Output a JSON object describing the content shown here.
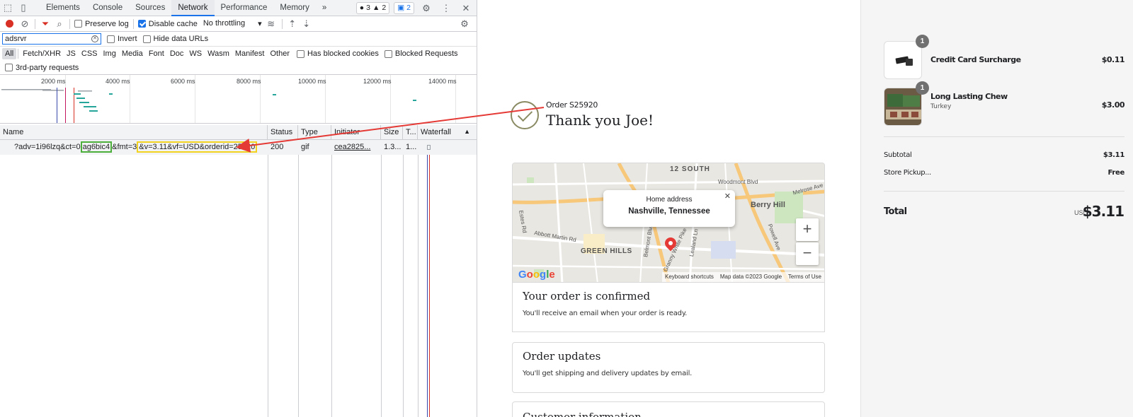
{
  "devtools": {
    "tabs": [
      "Elements",
      "Console",
      "Sources",
      "Network",
      "Performance",
      "Memory"
    ],
    "active_tab": "Network",
    "more_tabs": "»",
    "badges": {
      "errors": "3",
      "warnings": "2",
      "messages": "2"
    },
    "toolbar": {
      "preserve_log": "Preserve log",
      "disable_cache": "Disable cache",
      "throttling": "No throttling"
    },
    "filter": {
      "value": "adsrvr",
      "invert": "Invert",
      "hide_data_urls": "Hide data URLs"
    },
    "types": [
      "All",
      "Fetch/XHR",
      "JS",
      "CSS",
      "Img",
      "Media",
      "Font",
      "Doc",
      "WS",
      "Wasm",
      "Manifest",
      "Other"
    ],
    "has_blocked_cookies": "Has blocked cookies",
    "blocked_requests": "Blocked Requests",
    "third_party": "3rd-party requests",
    "timeline_ticks": [
      "2000 ms",
      "4000 ms",
      "6000 ms",
      "8000 ms",
      "10000 ms",
      "12000 ms",
      "14000 ms"
    ],
    "columns": [
      "Name",
      "Status",
      "Type",
      "Initiator",
      "Size",
      "T...",
      "Waterfall"
    ],
    "row": {
      "name_prefix": "?adv=1i96lzq&ct=0",
      "name_green": "ag6bic4",
      "name_mid": "&fmt=3",
      "name_yellow": "&v=3.11&vf=USD&orderid=25920",
      "status": "200",
      "type": "gif",
      "initiator": "cea2825...",
      "size": "1.3...",
      "time": "1..."
    },
    "highlight_colors": {
      "green": "#4caf3b",
      "yellow": "#f2d322",
      "arrow": "#e53935"
    }
  },
  "confirmation": {
    "order_number": "Order S25920",
    "thank_you": "Thank you Joe!",
    "map": {
      "popup_title": "Home address",
      "popup_location": "Nashville, Tennessee",
      "labels": [
        "12 SOUTH",
        "Berry Hill",
        "GREEN HILLS",
        "Abbott Martin Rd",
        "Belmont Blvd",
        "Granny White Pike",
        "Estes Rd",
        "Melrose Ave",
        "Powell Ave",
        "Lealand Ln",
        "Woodmont Blvd"
      ],
      "footer_shortcuts": "Keyboard shortcuts",
      "footer_data": "Map data ©2023 Google",
      "footer_terms": "Terms of Use",
      "logo": "Google",
      "zoom_in": "+",
      "zoom_out": "−"
    },
    "cards": [
      {
        "title": "Your order is confirmed",
        "body": "You'll receive an email when your order is ready."
      },
      {
        "title": "Order updates",
        "body": "You'll get shipping and delivery updates by email."
      }
    ],
    "cut_card_title": "Customer information"
  },
  "summary": {
    "items": [
      {
        "name": "Credit Card Surcharge",
        "variant": "",
        "qty": "1",
        "price": "$0.11"
      },
      {
        "name": "Long Lasting Chew",
        "variant": "Turkey",
        "qty": "1",
        "price": "$3.00"
      }
    ],
    "subtotal_label": "Subtotal",
    "subtotal_value": "$3.11",
    "shipping_label": "Store Pickup...",
    "shipping_value": "Free",
    "total_label": "Total",
    "total_currency": "USD",
    "total_value": "$3.11"
  }
}
